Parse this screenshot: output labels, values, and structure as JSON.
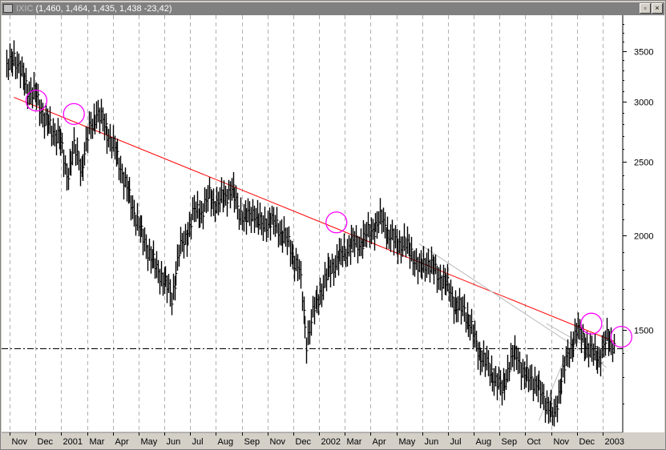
{
  "window": {
    "title_prefix": "IXIC",
    "title_quote": "(1,460, 1,464, 1,435, 1,438 -23,42)",
    "restore_label": "▫",
    "close_label": "×"
  },
  "chart_data": {
    "type": "line",
    "style": "ohlc-bars",
    "scale": "log",
    "ylim": [
      1100,
      3900
    ],
    "y_ticks": [
      1500,
      2000,
      2500,
      3000,
      3500
    ],
    "y_tick_labels": [
      "1500",
      "2000",
      "2500",
      "3000",
      "3500"
    ],
    "x_tick_labels": [
      "Nov",
      "Dec",
      "2001",
      "Mar",
      "Apr",
      "May",
      "Jun",
      "Jul",
      "Aug",
      "Sep",
      "Nov",
      "Dec",
      "2002",
      "Mar",
      "Apr",
      "May",
      "Jun",
      "Jul",
      "Aug",
      "Sep",
      "Oct",
      "Nov",
      "Dec",
      "2003"
    ],
    "grid": true,
    "series": [
      {
        "values": [
          3300,
          3450,
          3250,
          3100,
          3050,
          2850,
          2750,
          2700,
          2400,
          2600,
          2450,
          2750,
          2900,
          2800,
          2650,
          2500,
          2300,
          2150,
          2000,
          1900,
          1800,
          1750,
          1650,
          1900,
          2000,
          2150,
          2150,
          2250,
          2200,
          2250,
          2300,
          2150,
          2100,
          2150,
          2050,
          2100,
          2050,
          2000,
          1900,
          1800,
          1450,
          1600,
          1700,
          1800,
          1850,
          1900,
          1950,
          1950,
          2000,
          2050,
          2100,
          2000,
          1950,
          1950,
          1900,
          1800,
          1850,
          1800,
          1750,
          1700,
          1600,
          1600,
          1500,
          1400,
          1350,
          1300,
          1250,
          1350,
          1400,
          1300,
          1300,
          1250,
          1200,
          1150,
          1300,
          1400,
          1500,
          1450,
          1400,
          1380,
          1460,
          1440
        ]
      }
    ],
    "annotations": [
      {
        "type": "trendline",
        "color": "#ff0000",
        "from": [
          1,
          3040
        ],
        "to": [
          81,
          1450
        ]
      },
      {
        "type": "trendline",
        "color": "#bbbbbb",
        "from": [
          55,
          1950
        ],
        "to": [
          80,
          1340
        ]
      },
      {
        "type": "trendline",
        "color": "#bbbbbb",
        "from": [
          72,
          1530
        ],
        "to": [
          80,
          1380
        ]
      },
      {
        "type": "trendline",
        "color": "#bbbbbb",
        "from": [
          71,
          1140
        ],
        "to": [
          75,
          1420
        ]
      },
      {
        "type": "hline",
        "style": "dash-dot",
        "color": "#000000",
        "value": 1420
      },
      {
        "type": "circle",
        "color": "#ff00ff",
        "at": [
          4,
          3010
        ]
      },
      {
        "type": "circle",
        "color": "#ff00ff",
        "at": [
          9,
          2890
        ]
      },
      {
        "type": "circle",
        "color": "#ff00ff",
        "at": [
          44,
          2080
        ]
      },
      {
        "type": "circle",
        "color": "#ff00ff",
        "at": [
          78,
          1530
        ]
      },
      {
        "type": "circle",
        "color": "#ff00ff",
        "at": [
          82,
          1470
        ]
      }
    ]
  }
}
